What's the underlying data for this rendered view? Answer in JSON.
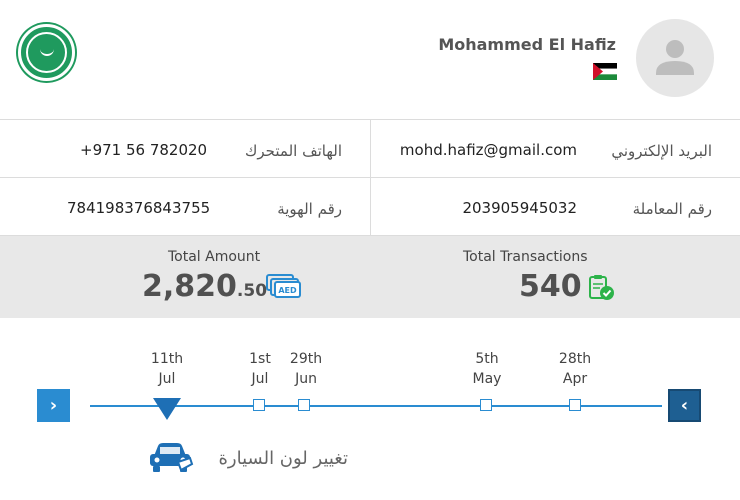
{
  "user": {
    "name": "Mohammed El Hafiz"
  },
  "info": {
    "email_label": "البريد الإلكتروني",
    "email_value": "mohd.hafiz@gmail.com",
    "mobile_label": "الهاتف المتحرك",
    "mobile_value": "+971 56 782020",
    "transaction_label": "رقم المعاملة",
    "transaction_value": "203905945032",
    "id_label": "رقم الهوية",
    "id_value": "784198376843755"
  },
  "stats": {
    "transactions_label": "Total Transactions",
    "transactions_value": "540",
    "amount_label": "Total Amount",
    "amount_whole": "2,820",
    "amount_decimal": ".50",
    "currency_badge": "AED"
  },
  "timeline": {
    "dates": [
      {
        "day": "11th",
        "month": "Jul"
      },
      {
        "day": "1st",
        "month": "Jul"
      },
      {
        "day": "29th",
        "month": "Jun"
      },
      {
        "day": "5th",
        "month": "May"
      },
      {
        "day": "28th",
        "month": "Apr"
      }
    ],
    "prev_icon": "›",
    "next_icon": "‹",
    "action_label": "تغيير لون السيارة"
  },
  "colors": {
    "brand_green": "#1f9a5e",
    "timeline_blue": "#2a8cd1",
    "marker_blue": "#1e6fb5",
    "check_green": "#2db34a"
  }
}
